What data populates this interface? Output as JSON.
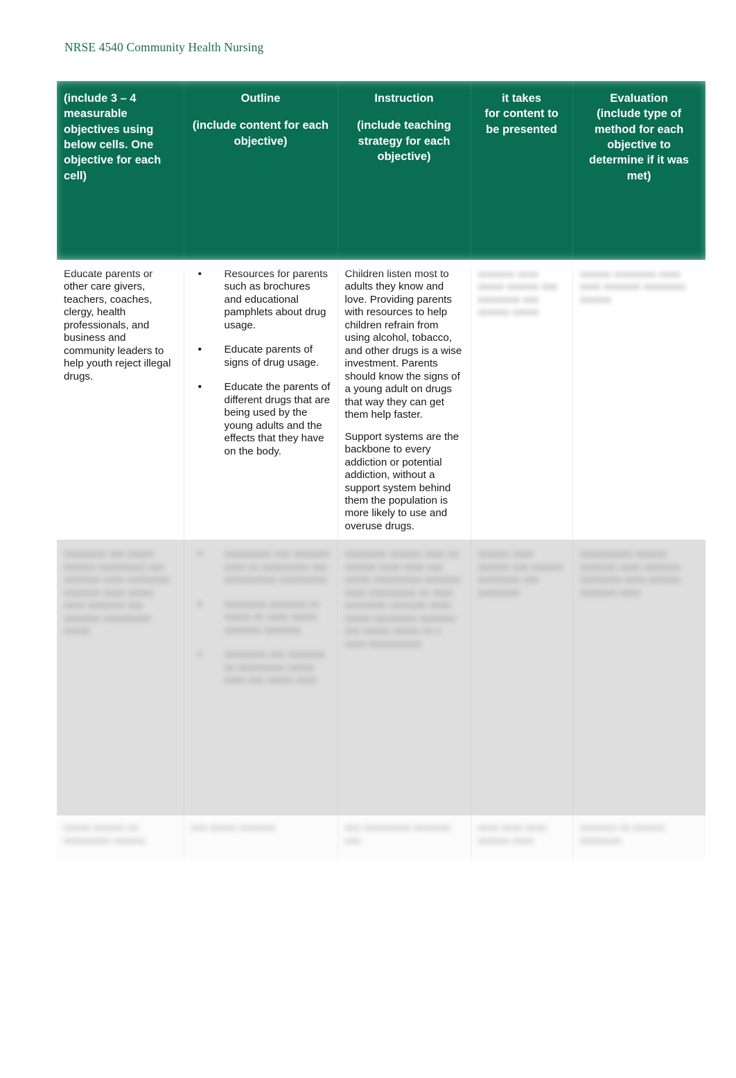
{
  "document": {
    "running_header": "NRSE 4540 Community Health Nursing",
    "accent_color": "#1b6b5b",
    "table_header_color": "#0a6e52",
    "page_background": "#ffffff"
  },
  "table": {
    "columns": [
      {
        "key": "objectives",
        "title": "",
        "subtitle": " (include 3 – 4 measurable objectives using below cells. One objective for each cell)",
        "align": "left"
      },
      {
        "key": "outline",
        "title": "Outline",
        "subtitle": "(include content for each objective)",
        "align": "center"
      },
      {
        "key": "instruction",
        "title": "Instruction",
        "subtitle": "(include teaching strategy for each objective)",
        "align": "center"
      },
      {
        "key": "time",
        "title": "it takes",
        "subtitle": "for content to be presented",
        "align": "center"
      },
      {
        "key": "evaluation",
        "title": "Evaluation",
        "subtitle": "(include type of method for each objective to determine if it was met)",
        "align": "center"
      }
    ],
    "rows": [
      {
        "id": "row-1",
        "state": "visible",
        "objectives": "Educate parents or other care givers, teachers, coaches, clergy, health professionals, and business and community leaders to help youth reject illegal drugs.",
        "outline_bullets": [
          "Resources for parents such as brochures and educational pamphlets about drug usage.",
          "Educate parents of signs of drug usage.",
          "Educate the parents of different drugs that are being used by the young adults and the effects that they have on the body."
        ],
        "instruction_paragraphs": [
          "Children listen most to adults they know and love. Providing parents with resources to help children refrain from using alcohol, tobacco, and other drugs is a wise investment. Parents should know the signs of a young adult on drugs that way they can get them help faster.",
          "Support systems are the backbone to every addiction or potential addiction, without a support system behind them the population is more likely to use and overuse drugs."
        ],
        "time_redacted": "xxxxxxx xxxx xxxxx xxxxxx xxx xxxxxxxx xxx xxxxxx xxxxx",
        "evaluation_redacted": "xxxxxx xxxxxxxx xxxx xxxx xxxxxxx xxxxxxxx xxxxxx"
      },
      {
        "id": "row-2",
        "state": "redacted",
        "objectives_redacted": "xxxxxxxx xxx xxxxx xxxxxx xxxxxxxxx xxx xxxxxxx xxxx xxxxxxxx xxxxxxx xxxx xxxxx xxxx xxxxxxx xxx xxxxxxx xxxxxxxxx xxxxx",
        "outline_bullets_redacted": [
          "xxxxxxxxx xxx xxxxxxx xxxx xx xxxxxxxxx xxx xxxxxxxxxx xxxxxxxxx",
          "xxxxxxxx xxxxxxx xx xxxxx xx xxxx xxxxx xxxxxxx xxxxxxx",
          "xxxxxxxx xxx xxxxxxx xx xxxxxxxxx xxxxx xxxx xxx xxxxx xxxx"
        ],
        "instruction_redacted": "xxxxxxxx xxxxxx xxxx xx xxxxxx xxxx xxxx xxx xxxxx xxxxxxxxx xxxxxxx xxxx xxxxxxxxx xx xxxx xxxxxxxx xxxxxxx xxxx xxxxx xxxxxxxx xxxxxxx xxx xxxxx xxxxx xx x xxxx xxxxxxxxxx",
        "time_redacted": "xxxxxx xxxx xxxxxx xxx xxxxxx xxxxxxxx xxx xxxxxxxx",
        "evaluation_redacted": "xxxxxxxxxx xxxxxx xxxxxxx xxxx xxxxxxx xxxxxxxx xxxx xxxxxx xxxxxxx xxxx"
      },
      {
        "id": "row-3",
        "state": "redacted",
        "objectives_redacted": "xxxxx xxxxxx xx xxxxxxxxx xxxxxx",
        "outline_redacted": "xxx xxxxx xxxxxxx",
        "instruction_redacted": "xxx xxxxxxxxx xxxxxxx xxx",
        "time_redacted": "xxxx xxxx xxxx xxxxxx xxxx",
        "evaluation_redacted": "xxxxxxx xx xxxxxx xxxxxxxx"
      }
    ]
  }
}
